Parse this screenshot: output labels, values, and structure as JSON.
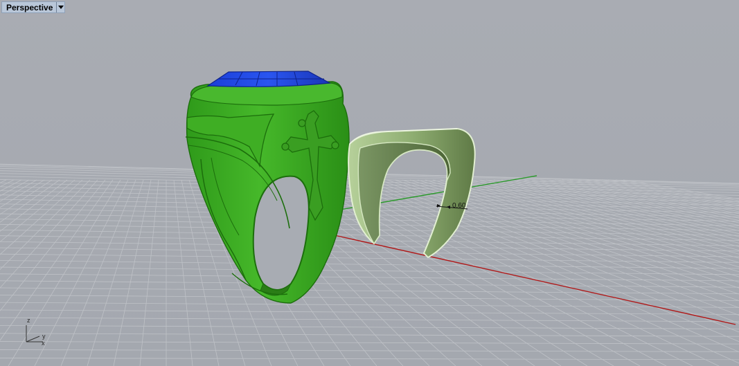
{
  "viewport": {
    "name": "Perspective",
    "menu_icon": "triangle-down-icon"
  },
  "dimension": {
    "value": "0.60"
  },
  "axes": {
    "z": "z",
    "x": "x",
    "y": "y"
  },
  "colors": {
    "background": "#a8acb3",
    "grid_line": "#bcbfc4",
    "x_axis": "#b01818",
    "y_axis": "#2a9a2a",
    "selected_shank": "#34a81c",
    "gem": "#1a3fd6",
    "band_piece": "#a7c48a"
  }
}
